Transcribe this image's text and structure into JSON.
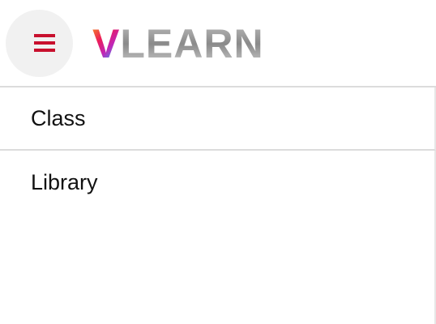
{
  "header": {
    "menu_icon": "hamburger-menu-icon",
    "logo_first": "V",
    "logo_rest": "LEARN",
    "accent_color": "#c8102e"
  },
  "nav": {
    "items": [
      {
        "label": "Class"
      },
      {
        "label": "Library"
      }
    ]
  }
}
